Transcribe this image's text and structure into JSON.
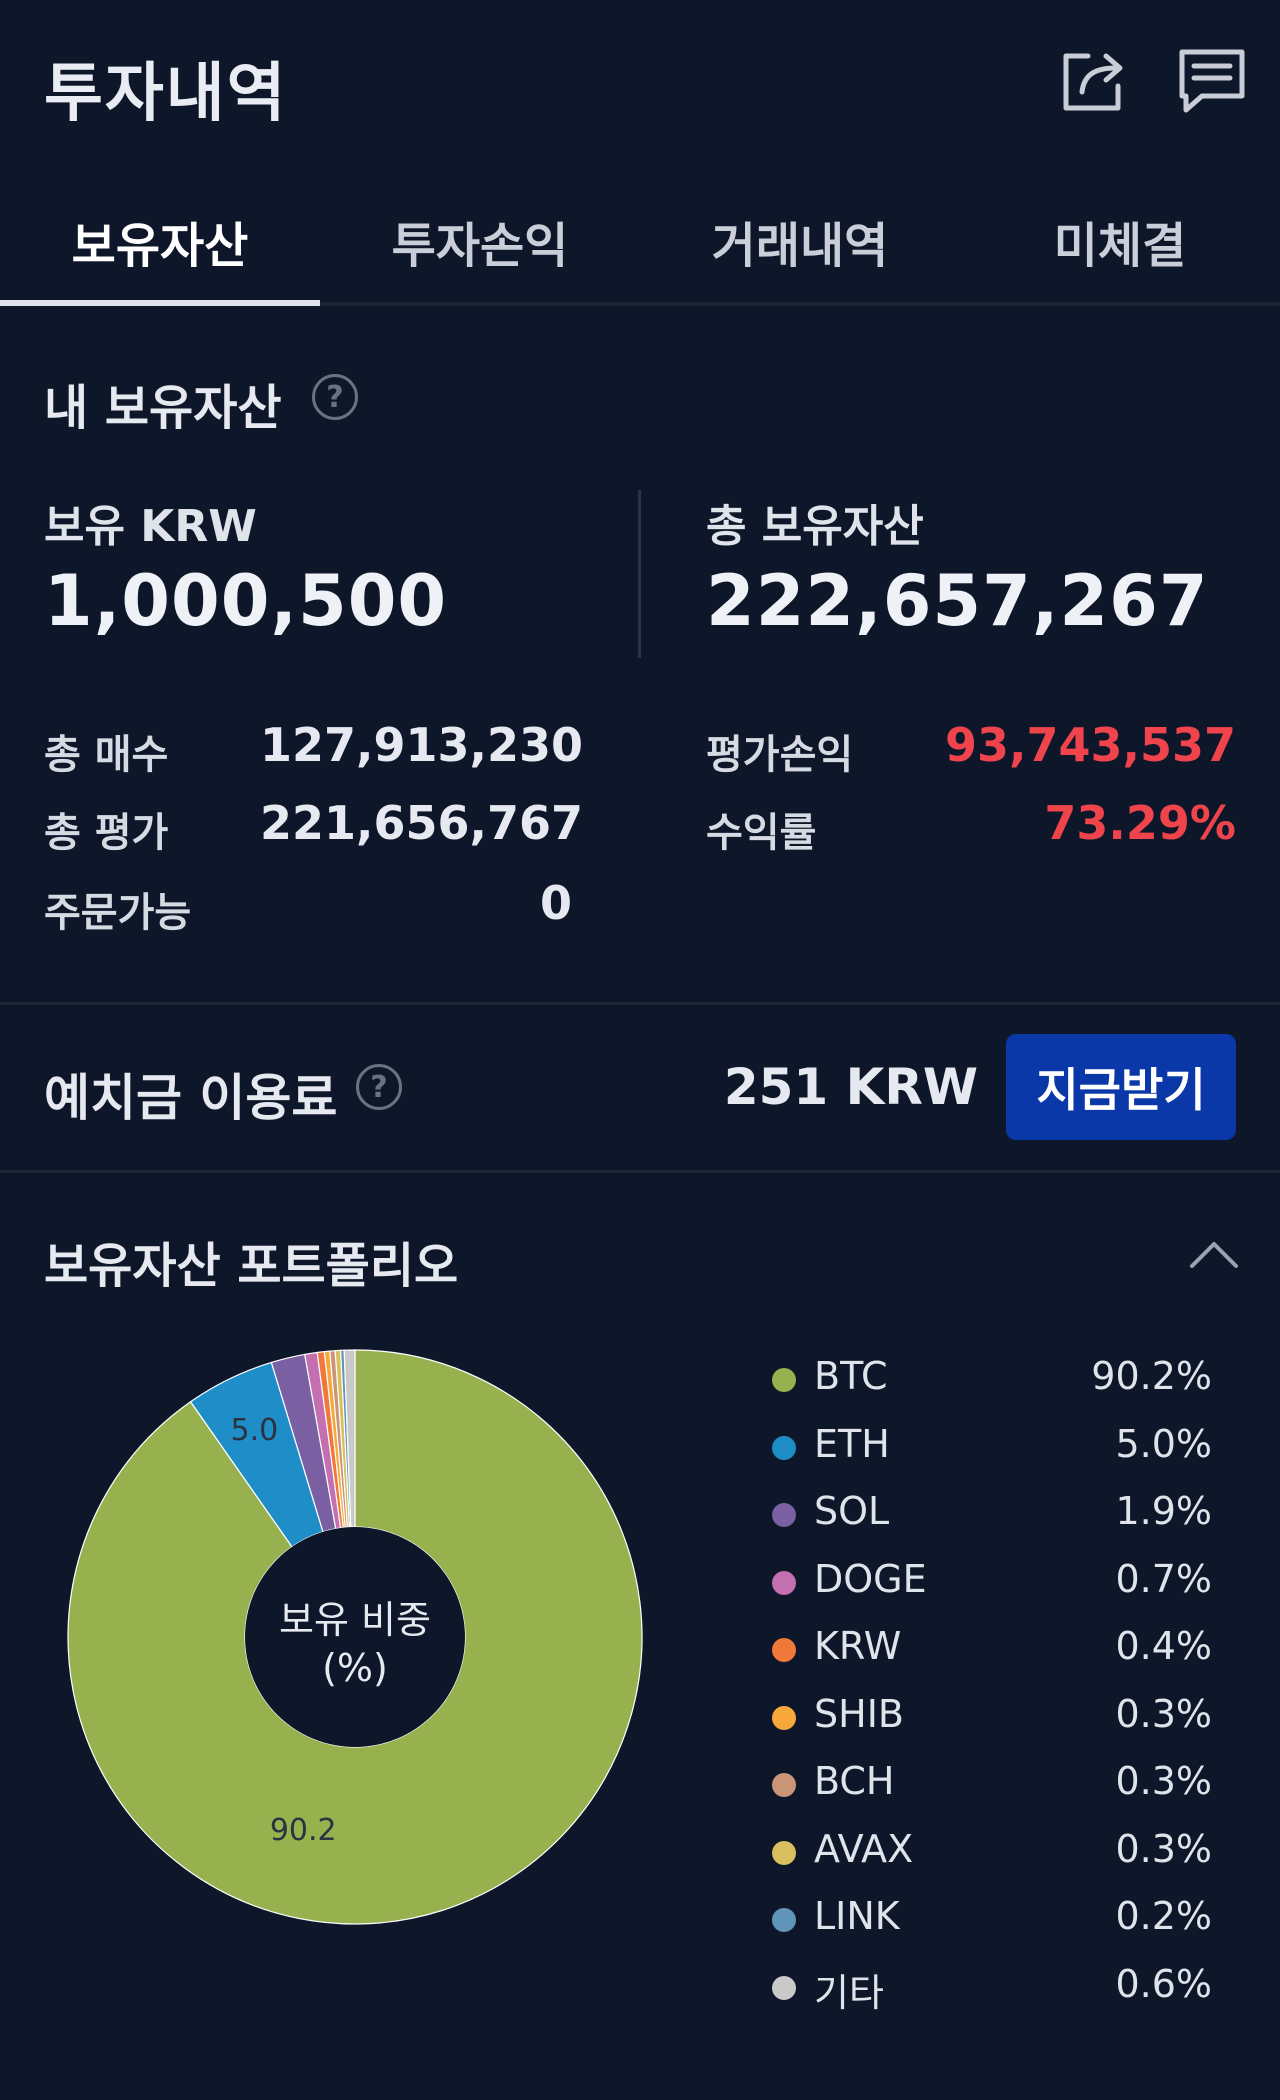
{
  "header": {
    "title": "투자내역",
    "share_icon": "share-icon",
    "notes_icon": "message-icon"
  },
  "tabs": [
    {
      "label": "보유자산",
      "active": true
    },
    {
      "label": "투자손익",
      "active": false
    },
    {
      "label": "거래내역",
      "active": false
    },
    {
      "label": "미체결",
      "active": false
    }
  ],
  "holdings": {
    "title": "내 보유자산",
    "help_icon": "help-icon",
    "krw_label": "보유 KRW",
    "krw_value": "1,000,500",
    "total_label": "총 보유자산",
    "total_value": "222,657,267",
    "rows_left": [
      {
        "label": "총 매수",
        "value": "127,913,230"
      },
      {
        "label": "총 평가",
        "value": "221,656,767"
      },
      {
        "label": "주문가능",
        "value": "0"
      }
    ],
    "rows_right": [
      {
        "label": "평가손익",
        "value": "93,743,537"
      },
      {
        "label": "수익률",
        "value": "73.29%"
      }
    ],
    "positive_color": "#f0444d"
  },
  "deposit": {
    "title": "예치금 이용료",
    "amount": "251 KRW",
    "button_label": "지금받기",
    "button_color": "#0a38a8"
  },
  "portfolio": {
    "title": "보유자산 포트폴리오",
    "center_label_1": "보유 비중",
    "center_label_2": "(%)",
    "slice_labels": [
      "5.0",
      "90.2"
    ]
  },
  "chart_data": {
    "type": "pie",
    "title": "",
    "categories": [
      "BTC",
      "ETH",
      "SOL",
      "DOGE",
      "KRW",
      "SHIB",
      "BCH",
      "AVAX",
      "LINK",
      "기타"
    ],
    "values": [
      90.2,
      5.0,
      1.9,
      0.7,
      0.4,
      0.3,
      0.3,
      0.3,
      0.2,
      0.6
    ],
    "value_labels": [
      "90.2%",
      "5.0%",
      "1.9%",
      "0.7%",
      "0.4%",
      "0.3%",
      "0.3%",
      "0.3%",
      "0.2%",
      "0.6%"
    ],
    "colors": [
      "#97b14f",
      "#1f8ec8",
      "#7a5fa3",
      "#c46fb0",
      "#f0783a",
      "#f7a83a",
      "#c99477",
      "#d9bf5d",
      "#5e95b8",
      "#c9c9c9"
    ],
    "donut": true,
    "legend_position": "right"
  }
}
